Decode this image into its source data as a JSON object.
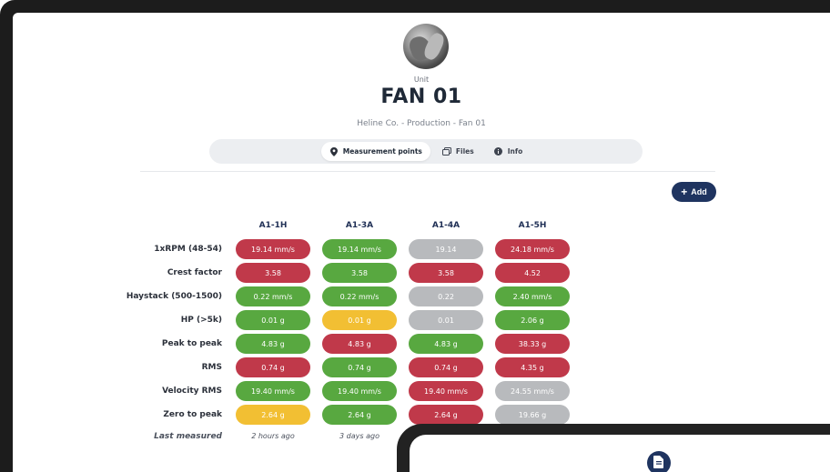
{
  "colors": {
    "red": "#c0394a",
    "green": "#58a840",
    "gray": "#b8babd",
    "yellow": "#f2bf33",
    "navy": "#1f3460"
  },
  "header": {
    "unit_label": "Unit",
    "title": "FAN 01",
    "breadcrumb": "Heline Co. - Production - Fan 01"
  },
  "tabs": [
    {
      "label": "Measurement points",
      "icon": "location-pin-icon",
      "active": true
    },
    {
      "label": "Files",
      "icon": "files-icon",
      "active": false
    },
    {
      "label": "Info",
      "icon": "info-icon",
      "active": false
    }
  ],
  "add_button": {
    "label": "Add",
    "icon": "plus-icon"
  },
  "table": {
    "columns": [
      "A1-1H",
      "A1-3A",
      "A1-4A",
      "A1-5H"
    ],
    "rows": [
      {
        "label": "1xRPM (48-54)",
        "cells": [
          {
            "value": "19.14 mm/s",
            "status": "red"
          },
          {
            "value": "19.14 mm/s",
            "status": "green"
          },
          {
            "value": "19.14",
            "status": "gray"
          },
          {
            "value": "24.18 mm/s",
            "status": "red"
          }
        ]
      },
      {
        "label": "Crest factor",
        "cells": [
          {
            "value": "3.58",
            "status": "red"
          },
          {
            "value": "3.58",
            "status": "green"
          },
          {
            "value": "3.58",
            "status": "red"
          },
          {
            "value": "4.52",
            "status": "red"
          }
        ]
      },
      {
        "label": "Haystack (500-1500)",
        "cells": [
          {
            "value": "0.22 mm/s",
            "status": "green"
          },
          {
            "value": "0.22 mm/s",
            "status": "green"
          },
          {
            "value": "0.22",
            "status": "gray"
          },
          {
            "value": "2.40 mm/s",
            "status": "green"
          }
        ]
      },
      {
        "label": "HP (>5k)",
        "cells": [
          {
            "value": "0.01 g",
            "status": "green"
          },
          {
            "value": "0.01 g",
            "status": "yellow"
          },
          {
            "value": "0.01",
            "status": "gray"
          },
          {
            "value": "2.06 g",
            "status": "green"
          }
        ]
      },
      {
        "label": "Peak to peak",
        "cells": [
          {
            "value": "4.83 g",
            "status": "green"
          },
          {
            "value": "4.83 g",
            "status": "red"
          },
          {
            "value": "4.83 g",
            "status": "green"
          },
          {
            "value": "38.33 g",
            "status": "red"
          }
        ]
      },
      {
        "label": "RMS",
        "cells": [
          {
            "value": "0.74 g",
            "status": "red"
          },
          {
            "value": "0.74 g",
            "status": "green"
          },
          {
            "value": "0.74 g",
            "status": "red"
          },
          {
            "value": "4.35 g",
            "status": "red"
          }
        ]
      },
      {
        "label": "Velocity RMS",
        "cells": [
          {
            "value": "19.40 mm/s",
            "status": "green"
          },
          {
            "value": "19.40 mm/s",
            "status": "green"
          },
          {
            "value": "19.40 mm/s",
            "status": "red"
          },
          {
            "value": "24.55 mm/s",
            "status": "gray"
          }
        ]
      },
      {
        "label": "Zero to peak",
        "cells": [
          {
            "value": "2.64 g",
            "status": "yellow"
          },
          {
            "value": "2.64 g",
            "status": "green"
          },
          {
            "value": "2.64 g",
            "status": "red"
          },
          {
            "value": "19.66 g",
            "status": "gray"
          }
        ]
      }
    ],
    "last_measured": {
      "label": "Last measured",
      "values": [
        "2 hours ago",
        "3 days ago"
      ]
    }
  }
}
